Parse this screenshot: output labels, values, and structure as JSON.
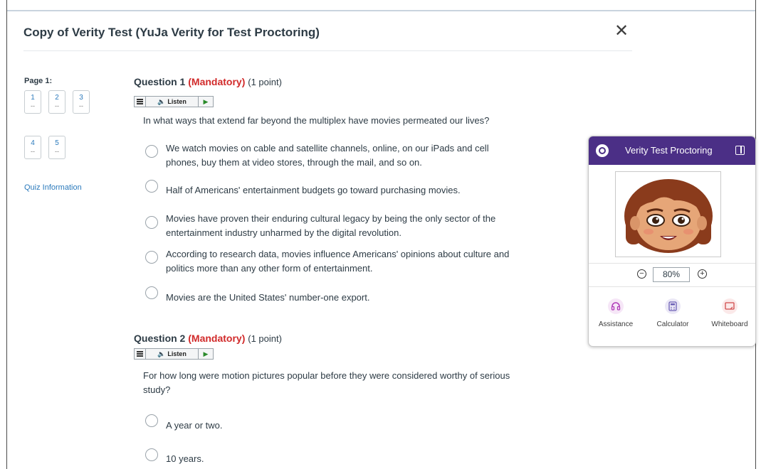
{
  "dialog": {
    "title": "Copy of Verity Test (YuJa Verity for Test Proctoring)",
    "close_symbol": "✕"
  },
  "sidebar": {
    "page_label": "Page 1:",
    "questions": [
      {
        "num": "1",
        "status": "--"
      },
      {
        "num": "2",
        "status": "--"
      },
      {
        "num": "3",
        "status": "--"
      },
      {
        "num": "4",
        "status": "--"
      },
      {
        "num": "5",
        "status": "--"
      }
    ],
    "quiz_info_link": "Quiz Information"
  },
  "listen_label": "Listen",
  "questions": [
    {
      "heading": "Question 1",
      "mandatory": "(Mandatory)",
      "points": "(1 point)",
      "text": "In what ways that extend far beyond the multiplex have movies permeated our lives?",
      "options": [
        "We watch movies on cable and satellite channels, online, on our iPads and cell phones, buy them at video stores, through the mail, and so on.",
        "Half of Americans' entertainment budgets go toward purchasing movies.",
        "Movies have proven their enduring cultural legacy by being the only sector of the entertainment industry unharmed by the digital revolution.",
        "According to research data, movies influence Americans' opinions about culture and politics more than any other form of entertainment.",
        "Movies are the United States' number-one export."
      ]
    },
    {
      "heading": "Question 2",
      "mandatory": "(Mandatory)",
      "points": "(1 point)",
      "text": "For how long were motion pictures popular before they were considered worthy of serious study?",
      "options": [
        "A year or two.",
        "10 years."
      ]
    }
  ],
  "proctoring": {
    "title": "Verity Test Proctoring",
    "zoom": "80%",
    "tools": [
      {
        "label": "Assistance",
        "icon": "headset-icon",
        "color": "#b03ab8",
        "bg": "#f6e6f7"
      },
      {
        "label": "Calculator",
        "icon": "calculator-icon",
        "color": "#6b5fb5",
        "bg": "#ebe8f6"
      },
      {
        "label": "Whiteboard",
        "icon": "whiteboard-icon",
        "color": "#d04a4a",
        "bg": "#fbe9e9"
      }
    ]
  },
  "colors": {
    "accent_purple": "#4b2f86",
    "mandatory_red": "#d12a2a",
    "link_blue": "#2b7abc"
  }
}
